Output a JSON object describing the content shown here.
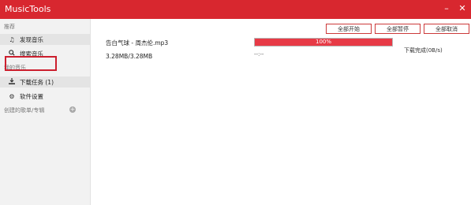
{
  "app": {
    "title": "MusicTools"
  },
  "window_controls": {
    "minimize_icon": "minimize-icon",
    "close_icon": "close-icon",
    "minimize_glyph": "–",
    "close_glyph": "✕"
  },
  "sidebar": {
    "section_recommend": "推荐",
    "item_discover": {
      "label": "发现音乐",
      "icon": "music-note-icon",
      "glyph": "♫"
    },
    "item_search": {
      "label": "搜索音乐",
      "icon": "search-icon",
      "glyph": "🔍"
    },
    "section_my_music": "我的音乐",
    "item_downloads": {
      "label": "下载任务 (1)",
      "icon": "download-icon",
      "glyph": "⭳"
    },
    "item_settings": {
      "label": "软件设置",
      "icon": "gear-icon",
      "glyph": "⚙"
    },
    "section_playlists": "创建的歌单/专辑",
    "add_playlist_glyph": "+"
  },
  "toolbar": {
    "start_all": "全部开始",
    "pause_all": "全部暂停",
    "cancel_all": "全部取消"
  },
  "task": {
    "filename": "告白气球 - 周杰伦.mp3",
    "size": "3.28MB/3.28MB",
    "progress_percent": 100,
    "progress_text": "100%",
    "status": "下载完成(0B/s)",
    "extra": "--:--"
  },
  "colors": {
    "accent": "#d8272f",
    "progress_fill": "#e73a46"
  }
}
